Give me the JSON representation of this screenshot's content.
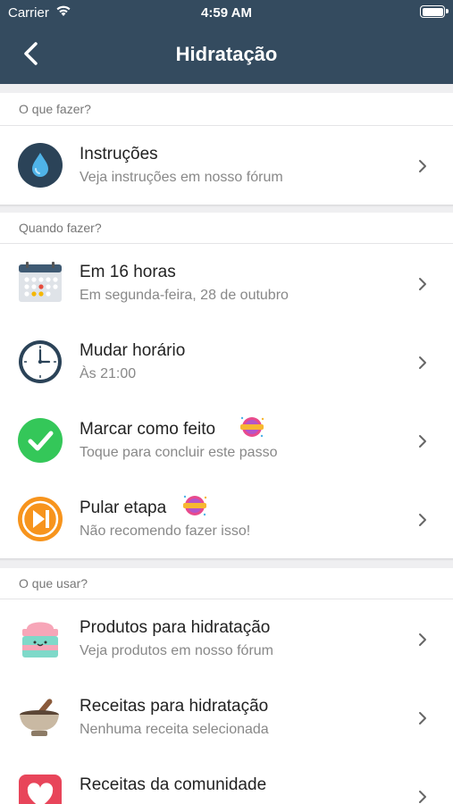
{
  "status_bar": {
    "carrier": "Carrier",
    "time": "4:59 AM"
  },
  "nav": {
    "title": "Hidratação"
  },
  "sections": [
    {
      "header": "O que fazer?",
      "items": [
        {
          "title": "Instruções",
          "subtitle": "Veja instruções em nosso fórum",
          "icon": "water-drop-icon"
        }
      ]
    },
    {
      "header": "Quando fazer?",
      "items": [
        {
          "title": "Em 16 horas",
          "subtitle": "Em segunda-feira, 28 de outubro",
          "icon": "calendar-icon"
        },
        {
          "title": "Mudar horário",
          "subtitle": "Às 21:00",
          "icon": "clock-icon"
        },
        {
          "title": "Marcar como feito",
          "subtitle": "Toque para concluir este passo",
          "icon": "checkmark-icon",
          "badge": "premium-badge-icon"
        },
        {
          "title": "Pular etapa",
          "subtitle": "Não recomendo fazer isso!",
          "icon": "skip-icon",
          "badge": "premium-badge-icon"
        }
      ]
    },
    {
      "header": "O que usar?",
      "items": [
        {
          "title": "Produtos para hidratação",
          "subtitle": "Veja produtos em nosso fórum",
          "icon": "cream-jar-icon"
        },
        {
          "title": "Receitas para hidratação",
          "subtitle": "Nenhuma receita selecionada",
          "icon": "mortar-pestle-icon"
        },
        {
          "title": "Receitas da comunidade",
          "subtitle": "",
          "icon": "heart-icon"
        }
      ]
    }
  ],
  "colors": {
    "nav_bg": "#344b5f",
    "check_green": "#34c759",
    "skip_orange": "#f7941d",
    "drop_circle": "#2b4358"
  }
}
